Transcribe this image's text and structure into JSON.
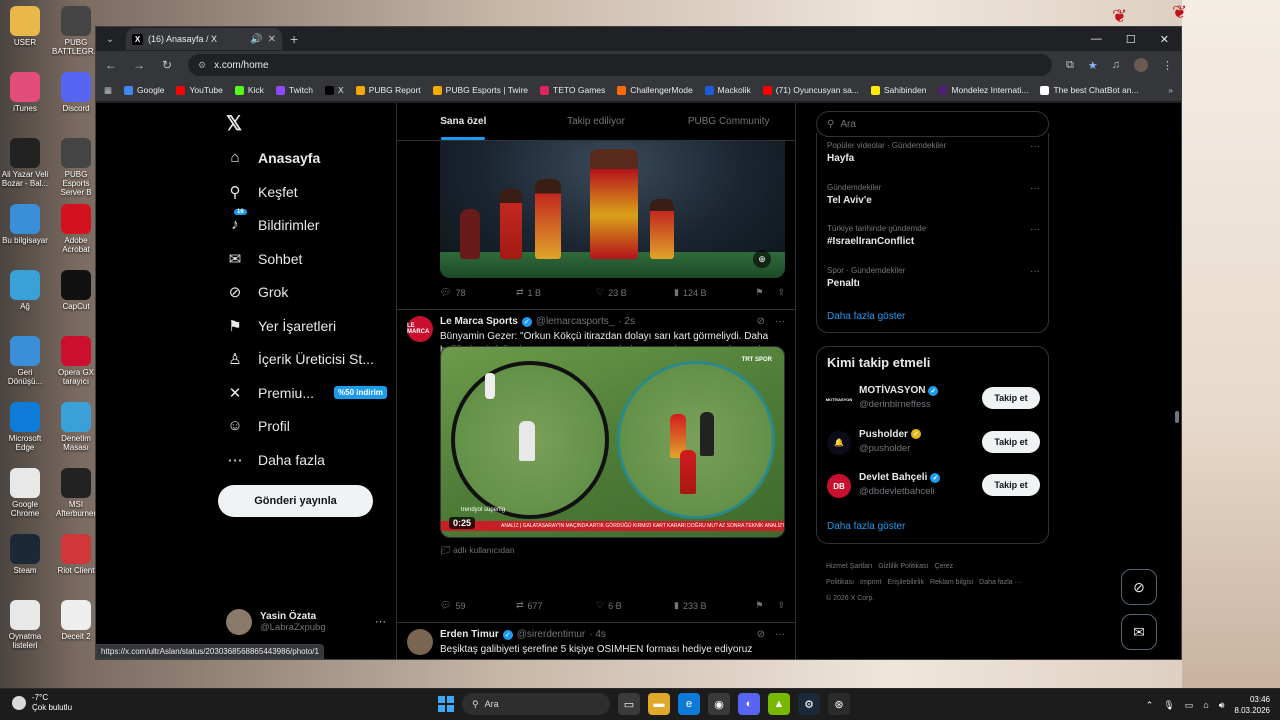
{
  "desktop": {
    "icons_left": [
      {
        "label": "USER",
        "icon": "folder-icon"
      },
      {
        "label": "iTunes",
        "icon": "itunes-icon"
      },
      {
        "label": "Ali Yazar Veli Bozar - Bal...",
        "icon": "video-icon"
      },
      {
        "label": "Bu bilgisayar",
        "icon": "computer-icon"
      },
      {
        "label": "Ağ",
        "icon": "network-icon"
      },
      {
        "label": "Geri Dönüşü...",
        "icon": "recycle-bin-icon"
      },
      {
        "label": "Microsoft Edge",
        "icon": "edge-icon"
      },
      {
        "label": "Google Chrome",
        "icon": "chrome-icon"
      },
      {
        "label": "Steam",
        "icon": "steam-icon"
      },
      {
        "label": "Oynatma listeleri",
        "icon": "playlist-icon"
      }
    ],
    "icons_col2": [
      {
        "label": "PUBG BATTLEGR...",
        "icon": "pubg-icon"
      },
      {
        "label": "Discord",
        "icon": "discord-icon"
      },
      {
        "label": "PUBG Esports Server B",
        "icon": "pubg-esports-icon"
      },
      {
        "label": "Adobe Acrobat",
        "icon": "acrobat-icon"
      },
      {
        "label": "CapCut",
        "icon": "capcut-icon"
      },
      {
        "label": "Opera GX tarayıcı",
        "icon": "opera-gx-icon"
      },
      {
        "label": "Denetim Masası",
        "icon": "control-panel-icon"
      },
      {
        "label": "MSI Afterburner",
        "icon": "msi-icon"
      },
      {
        "label": "Riot Client",
        "icon": "riot-icon"
      },
      {
        "label": "Deceit 2",
        "icon": "deceit-icon"
      }
    ]
  },
  "browser": {
    "tab_title": "(16) Anasayfa / X",
    "url": "x.com/home",
    "bookmarks": [
      {
        "label": "Google",
        "color": "#4285f4"
      },
      {
        "label": "YouTube",
        "color": "#ff0000"
      },
      {
        "label": "Kick",
        "color": "#53fc18"
      },
      {
        "label": "Twitch",
        "color": "#9146ff"
      },
      {
        "label": "X",
        "color": "#000000"
      },
      {
        "label": "PUBG Report",
        "color": "#f2a900"
      },
      {
        "label": "PUBG Esports | Twire",
        "color": "#f2a900"
      },
      {
        "label": "TETO Games",
        "color": "#e0245e"
      },
      {
        "label": "ChallengerMode",
        "color": "#ff6a00"
      },
      {
        "label": "Mackolik",
        "color": "#1e5bd8"
      },
      {
        "label": "(71) Oyuncusyan sa...",
        "color": "#ff0000"
      },
      {
        "label": "Sahibinden",
        "color": "#ffe800"
      },
      {
        "label": "Mondelez Internati...",
        "color": "#4f2170"
      },
      {
        "label": "The best ChatBot an...",
        "color": "#ffffff"
      }
    ],
    "status_url": "https://x.com/ultrAslan/status/2030368568865443986/photo/1"
  },
  "nav": {
    "items": [
      {
        "label": "Anasayfa",
        "icon": "home-icon",
        "glyph": "⌂",
        "active": true
      },
      {
        "label": "Keşfet",
        "icon": "search-icon",
        "glyph": "⚲"
      },
      {
        "label": "Bildirimler",
        "icon": "bell-icon",
        "glyph": "♪",
        "badge": "16"
      },
      {
        "label": "Sohbet",
        "icon": "mail-icon",
        "glyph": "✉"
      },
      {
        "label": "Grok",
        "icon": "grok-icon",
        "glyph": "⊘"
      },
      {
        "label": "Yer İşaretleri",
        "icon": "bookmark-icon",
        "glyph": "⚑"
      },
      {
        "label": "İçerik Üreticisi St...",
        "icon": "creator-icon",
        "glyph": "♙"
      },
      {
        "label": "Premiu...",
        "icon": "x-premium-icon",
        "glyph": "✕",
        "promo": "%50 indirim"
      },
      {
        "label": "Profil",
        "icon": "profile-icon",
        "glyph": "☺"
      },
      {
        "label": "Daha fazla",
        "icon": "more-icon",
        "glyph": "⋯"
      }
    ],
    "post_button": "Gönderi yayınla",
    "account_name": "Yasin Özata",
    "account_handle": "@LabraZxpubg"
  },
  "feed": {
    "tabs": [
      "Sana özel",
      "Takip ediliyor",
      "PUBG Community"
    ],
    "tweet0_stats": {
      "replies": "78",
      "reposts": "1 B",
      "likes": "23 B",
      "views": "124 B"
    },
    "tweet1": {
      "name": "Le Marca Sports",
      "handle": "@lemarcasports_",
      "time": "· 2s",
      "avatar_text": "LE MARCA",
      "text": "Bünyamin Gezer: \"Orkun Kökçü itirazdan dolayı sarı kart görmeliydi. Daha hafifinde Abdülkerim'e sarı gösterip cezalı duruma sokuyorsan Orkun'a da göstereceksin.\"",
      "duration": "0:25",
      "watermark": "trendyol süperlig",
      "channel": "TRT SPOR",
      "ticker": "ANALİZ | GALATASARAY'IN MAÇINDA ARTIK GÖRDÜĞÜ KIRMIZI KART KARARI DOĞRU MU? AZ SONRA TEKNİK ANALİZ'DE TRT",
      "label_note": "adlı kullanıcıdan",
      "stats": {
        "replies": "59",
        "reposts": "677",
        "likes": "6 B",
        "views": "233 B"
      }
    },
    "tweet2": {
      "name": "Erden Timur",
      "handle": "@sirerdentimur",
      "time": "· 4s",
      "text": "Beşiktaş galibiyeti şerefine 5 kişiye OSIMHEN forması hediye ediyoruz"
    }
  },
  "sidebar": {
    "search_placeholder": "Ara",
    "trends": [
      {
        "category": "Popüler videolar · Gündemdekiler",
        "title": "Hayfa"
      },
      {
        "category": "Gündemdekiler",
        "title": "Tel Aviv'e"
      },
      {
        "category": "Türkiye tarihinde gündemde",
        "title": "#IsraelIranConflict"
      },
      {
        "category": "Spor · Gündemdekiler",
        "title": "Penaltı"
      }
    ],
    "trends_more": "Daha fazla göster",
    "wtf_title": "Kimi takip etmeli",
    "who_to_follow": [
      {
        "name": "MOTİVASYON",
        "handle": "@derinblrneffess",
        "avatar": "MOTİVASYON",
        "verified": "blue"
      },
      {
        "name": "Pusholder",
        "handle": "@pusholder",
        "avatar": "🔔",
        "verified": "gold"
      },
      {
        "name": "Devlet Bahçeli",
        "handle": "@dbdevletbahceli",
        "avatar": "DB",
        "verified": "blue"
      }
    ],
    "follow_label": "Takip et",
    "wtf_more": "Daha fazla göster",
    "footer_links": [
      "Hizmet Şartları",
      "Gizlilik Politikası",
      "Çerez Politikası",
      "Imprint",
      "Erişilebilirlik",
      "Reklam bilgisi",
      "Daha fazla ···"
    ],
    "copyright": "© 2026 X Corp."
  },
  "taskbar": {
    "temp": "-7°C",
    "weather": "Çok bulutlu",
    "search": "Ara",
    "time": "03:46",
    "date": "8.03.2026"
  }
}
